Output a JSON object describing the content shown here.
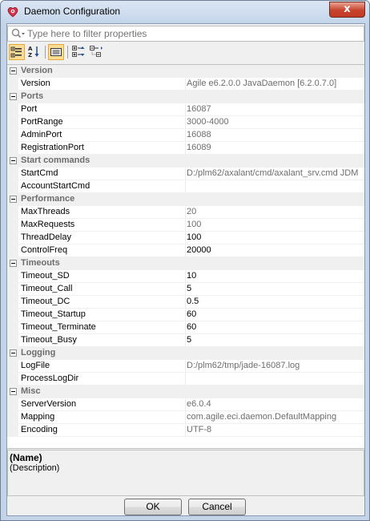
{
  "window": {
    "title": "Daemon Configuration",
    "close_label": "x"
  },
  "filter": {
    "placeholder": "Type here to filter properties"
  },
  "toolbar": {
    "items": [
      "categorized-view-icon",
      "alphabetical-sort-icon",
      "property-pages-icon",
      "expand-all-icon",
      "collapse-all-icon"
    ]
  },
  "categories": [
    {
      "label": "Version",
      "props": [
        {
          "name": "Version",
          "value": "Agile e6.2.0.0 JavaDaemon [6.2.0.7.0]",
          "readonly": true
        }
      ]
    },
    {
      "label": "Ports",
      "props": [
        {
          "name": "Port",
          "value": "16087",
          "readonly": true
        },
        {
          "name": "PortRange",
          "value": "3000-4000",
          "readonly": true
        },
        {
          "name": "AdminPort",
          "value": "16088",
          "readonly": true
        },
        {
          "name": "RegistrationPort",
          "value": "16089",
          "readonly": true
        }
      ]
    },
    {
      "label": "Start commands",
      "props": [
        {
          "name": "StartCmd",
          "value": "D:/plm62/axalant/cmd/axalant_srv.cmd JDM",
          "readonly": true
        },
        {
          "name": "AccountStartCmd",
          "value": "",
          "readonly": true
        }
      ]
    },
    {
      "label": "Performance",
      "props": [
        {
          "name": "MaxThreads",
          "value": "20",
          "readonly": true
        },
        {
          "name": "MaxRequests",
          "value": "100",
          "readonly": true
        },
        {
          "name": "ThreadDelay",
          "value": "100",
          "readonly": false
        },
        {
          "name": "ControlFreq",
          "value": "20000",
          "readonly": false
        }
      ]
    },
    {
      "label": "Timeouts",
      "props": [
        {
          "name": "Timeout_SD",
          "value": "10",
          "readonly": false
        },
        {
          "name": "Timeout_Call",
          "value": "5",
          "readonly": false
        },
        {
          "name": "Timeout_DC",
          "value": "0.5",
          "readonly": false
        },
        {
          "name": "Timeout_Startup",
          "value": "60",
          "readonly": false
        },
        {
          "name": "Timeout_Terminate",
          "value": "60",
          "readonly": false
        },
        {
          "name": "Timeout_Busy",
          "value": "5",
          "readonly": false
        }
      ]
    },
    {
      "label": "Logging",
      "props": [
        {
          "name": "LogFile",
          "value": "D:/plm62/tmp/jade-16087.log",
          "readonly": true
        },
        {
          "name": "ProcessLogDir",
          "value": "",
          "readonly": true
        }
      ]
    },
    {
      "label": "Misc",
      "props": [
        {
          "name": "ServerVersion",
          "value": "e6.0.4",
          "readonly": true
        },
        {
          "name": "Mapping",
          "value": "com.agile.eci.daemon.DefaultMapping",
          "readonly": true
        },
        {
          "name": "Encoding",
          "value": "UTF-8",
          "readonly": true
        }
      ]
    }
  ],
  "description": {
    "name": "(Name)",
    "text": "(Description)"
  },
  "buttons": {
    "ok": "OK",
    "cancel": "Cancel"
  },
  "colors": {
    "category_text": "#6d6d6d",
    "readonly_value": "#6d6d6d",
    "toolbar_active": "#f9dd94"
  }
}
